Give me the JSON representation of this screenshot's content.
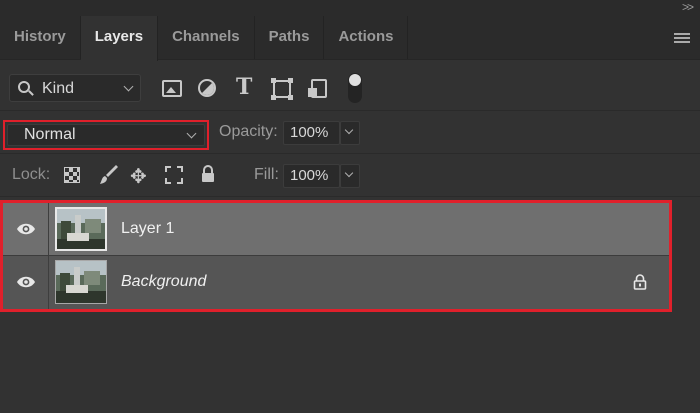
{
  "tabs": [
    "History",
    "Layers",
    "Channels",
    "Paths",
    "Actions"
  ],
  "active_tab": "Layers",
  "filter": {
    "label": "Kind"
  },
  "blend_mode": {
    "value": "Normal"
  },
  "opacity": {
    "label": "Opacity:",
    "value": "100%"
  },
  "lock": {
    "label": "Lock:"
  },
  "fill": {
    "label": "Fill:",
    "value": "100%"
  },
  "layers": [
    {
      "name": "Layer 1",
      "visible": true,
      "selected": true,
      "locked": false
    },
    {
      "name": "Background",
      "visible": true,
      "selected": false,
      "locked": true
    }
  ],
  "colors": {
    "panel": "#323232",
    "highlight": "#e0202b",
    "selected_layer": "#6f6f6f"
  }
}
